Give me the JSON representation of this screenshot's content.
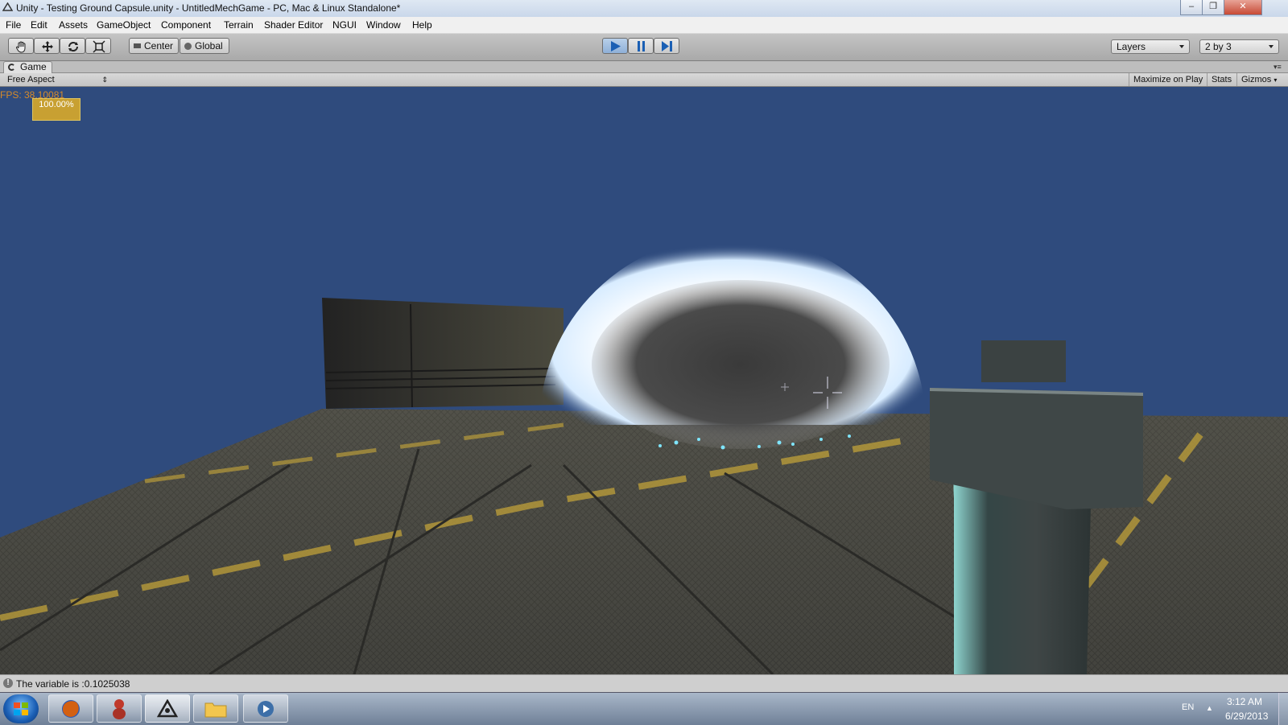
{
  "window": {
    "title": "Unity - Testing Ground Capsule.unity - UntitledMechGame - PC, Mac & Linux Standalone*",
    "controls": [
      "–",
      "❐",
      "✕"
    ]
  },
  "menu": [
    "File",
    "Edit",
    "Assets",
    "GameObject",
    "Component",
    "Terrain",
    "Shader Editor",
    "NGUI",
    "Window",
    "Help"
  ],
  "toolbar": {
    "tools": [
      "hand-icon",
      "move-icon",
      "rotate-icon",
      "scale-icon"
    ],
    "pivot_label": "Center",
    "space_label": "Global",
    "play_active": true,
    "layers_label": "Layers",
    "layout_label": "2 by 3"
  },
  "game_tab": {
    "label": "Game",
    "aspect": "Free Aspect",
    "maximize_label": "Maximize on Play",
    "stats_label": "Stats",
    "gizmos_label": "Gizmos"
  },
  "game_view": {
    "fps_text": "FPS: 38.10081",
    "zoom_text": "100.00%"
  },
  "status": {
    "message": "The variable is :0.1025038"
  },
  "taskbar": {
    "apps": [
      "firefox-icon",
      "pidgin-icon",
      "unity-icon",
      "folder-icon",
      "media-icon"
    ],
    "language": "EN",
    "time": "3:12 AM",
    "date": "6/29/2013"
  },
  "colors": {
    "sky": "#2f4b7d",
    "fps_text": "#d58a2a",
    "zoom_box": "#c8a032"
  }
}
